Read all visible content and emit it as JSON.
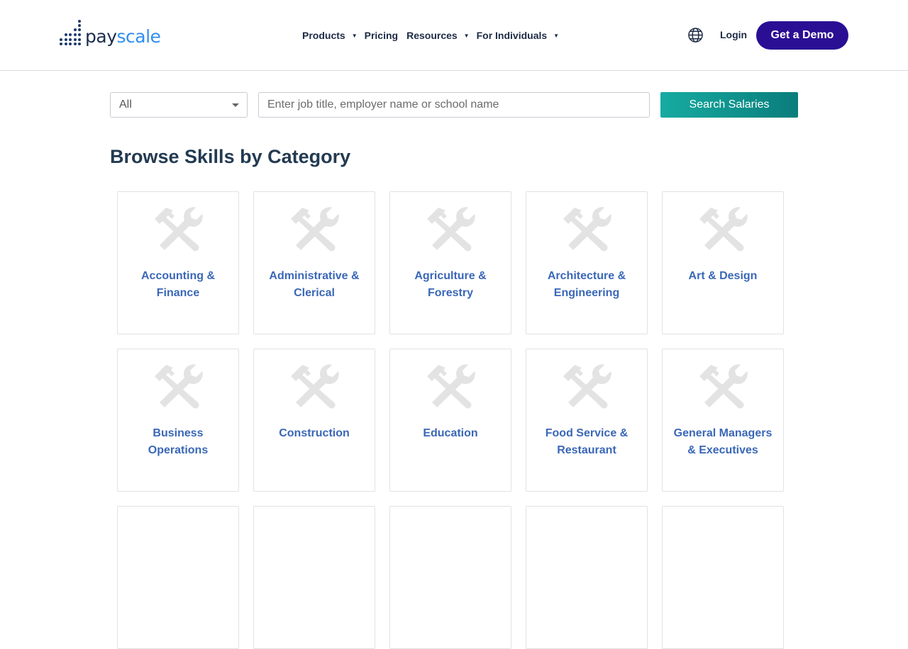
{
  "brand": {
    "logo_pay": "pay",
    "logo_scale": "scale"
  },
  "nav": {
    "products": "Products",
    "pricing": "Pricing",
    "resources": "Resources",
    "for_individuals": "For Individuals"
  },
  "header": {
    "login": "Login",
    "demo": "Get a Demo"
  },
  "search": {
    "select_value": "All",
    "placeholder": "Enter job title, employer name or school name",
    "button": "Search Salaries"
  },
  "page": {
    "title": "Browse Skills by Category"
  },
  "categories": [
    "Accounting & Finance",
    "Administrative & Clerical",
    "Agriculture & Forestry",
    "Architecture & Engineering",
    "Art & Design",
    "Business Operations",
    "Construction",
    "Education",
    "Food Service & Restaurant",
    "General Managers & Executives"
  ],
  "category_lines": [
    [
      "Accounting &",
      "Finance"
    ],
    [
      "Administrative &",
      "Clerical"
    ],
    [
      "Agriculture &",
      "Forestry"
    ],
    [
      "Architecture &",
      "Engineering"
    ],
    [
      "Art & Design"
    ],
    [
      "Business",
      "Operations"
    ],
    [
      "Construction"
    ],
    [
      "Education"
    ],
    [
      "Food Service &",
      "Restaurant"
    ],
    [
      "General Managers",
      "& Executives"
    ]
  ],
  "icons": {
    "category_icon": "hammer-wrench-icon",
    "language_icon": "globe-icon"
  },
  "colors": {
    "brand_dark": "#1d2d50",
    "brand_accent": "#2f8ff0",
    "demo_button": "#2a0f94",
    "search_button": "#0f9590",
    "category_link": "#3a67b7",
    "icon_gray": "#e3e3e3"
  }
}
